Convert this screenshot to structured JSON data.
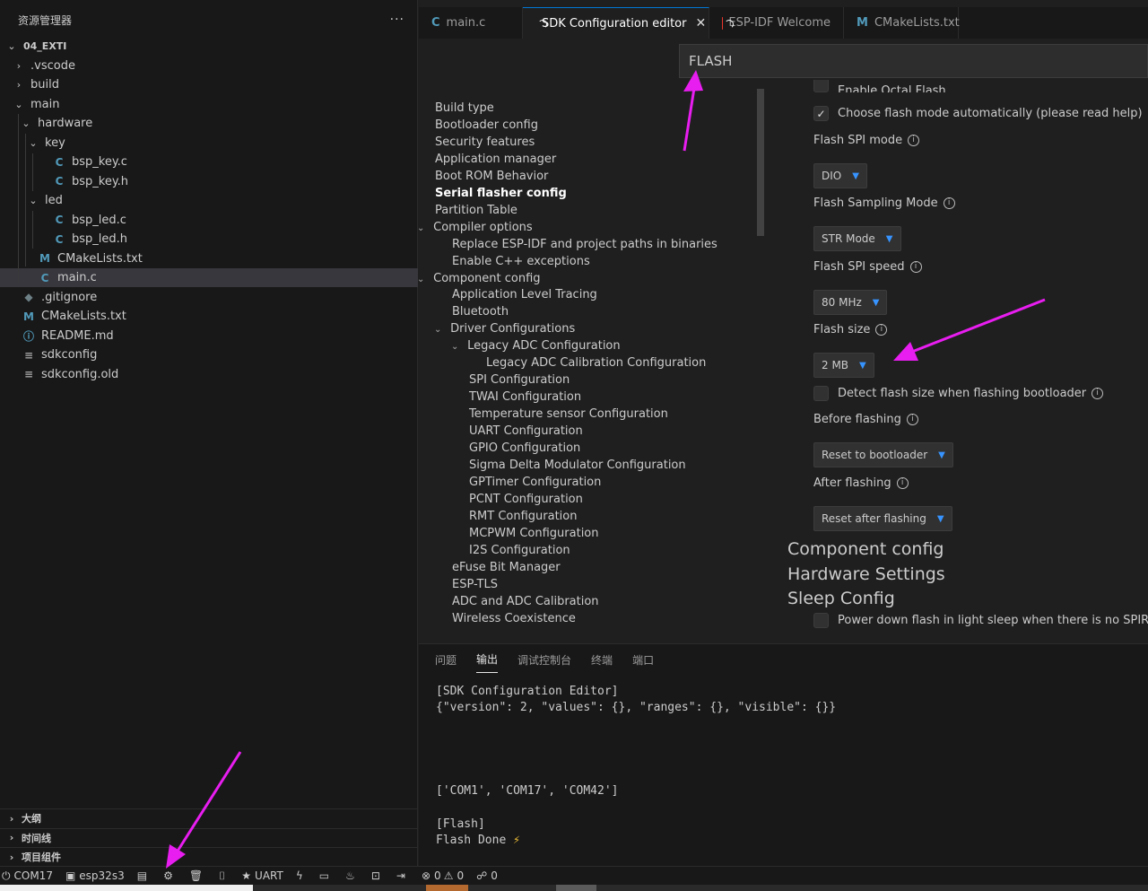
{
  "explorer": {
    "title": "资源管理器",
    "more": "···",
    "tree": [
      {
        "label": "04_EXTI",
        "depth": 0,
        "kind": "folder-open",
        "bold": true
      },
      {
        "label": ".vscode",
        "depth": 1,
        "kind": "folder"
      },
      {
        "label": "build",
        "depth": 1,
        "kind": "folder"
      },
      {
        "label": "main",
        "depth": 1,
        "kind": "folder-open"
      },
      {
        "label": "hardware",
        "depth": 2,
        "kind": "folder-open"
      },
      {
        "label": "key",
        "depth": 3,
        "kind": "folder-open"
      },
      {
        "label": "bsp_key.c",
        "depth": 4,
        "kind": "c"
      },
      {
        "label": "bsp_key.h",
        "depth": 4,
        "kind": "c"
      },
      {
        "label": "led",
        "depth": 3,
        "kind": "folder-open"
      },
      {
        "label": "bsp_led.c",
        "depth": 4,
        "kind": "c"
      },
      {
        "label": "bsp_led.h",
        "depth": 4,
        "kind": "c"
      },
      {
        "label": "CMakeLists.txt",
        "depth": 2,
        "kind": "m"
      },
      {
        "label": "main.c",
        "depth": 2,
        "kind": "c",
        "selected": true
      },
      {
        "label": ".gitignore",
        "depth": 1,
        "kind": "git"
      },
      {
        "label": "CMakeLists.txt",
        "depth": 1,
        "kind": "m"
      },
      {
        "label": "README.md",
        "depth": 1,
        "kind": "info"
      },
      {
        "label": "sdkconfig",
        "depth": 1,
        "kind": "eq"
      },
      {
        "label": "sdkconfig.old",
        "depth": 1,
        "kind": "eq"
      }
    ],
    "sections": [
      "大纲",
      "时间线",
      "项目组件"
    ]
  },
  "tabs": [
    {
      "label": "main.c",
      "icon": "c-file-icon",
      "active": false
    },
    {
      "label": "SDK Configuration editor",
      "icon": "espressif-icon",
      "active": true,
      "close": "✕"
    },
    {
      "label": "ESP-IDF Welcome",
      "icon": "espressif-icon",
      "active": false
    },
    {
      "label": "CMakeLists.txt",
      "icon": "cmake-icon",
      "active": false
    }
  ],
  "sdk_editor": {
    "search_value": "FLASH",
    "menu": [
      {
        "label": "Build type",
        "indent": 0
      },
      {
        "label": "Bootloader config",
        "indent": 0
      },
      {
        "label": "Security features",
        "indent": 0
      },
      {
        "label": "Application manager",
        "indent": 0
      },
      {
        "label": "Boot ROM Behavior",
        "indent": 0
      },
      {
        "label": "Serial flasher config",
        "indent": 0,
        "bold": true
      },
      {
        "label": "Partition Table",
        "indent": 0
      },
      {
        "label": "Compiler options",
        "indent": 0,
        "chevron": true
      },
      {
        "label": "Replace ESP-IDF and project paths in binaries",
        "indent": 1
      },
      {
        "label": "Enable C++ exceptions",
        "indent": 1
      },
      {
        "label": "Component config",
        "indent": 0,
        "chevron": true
      },
      {
        "label": "Application Level Tracing",
        "indent": 1
      },
      {
        "label": "Bluetooth",
        "indent": 1
      },
      {
        "label": "Driver Configurations",
        "indent": 1,
        "chevron": true
      },
      {
        "label": "Legacy ADC Configuration",
        "indent": 2,
        "chevron": true
      },
      {
        "label": "Legacy ADC Calibration Configuration",
        "indent": 3
      },
      {
        "label": "SPI Configuration",
        "indent": 2
      },
      {
        "label": "TWAI Configuration",
        "indent": 2
      },
      {
        "label": "Temperature sensor Configuration",
        "indent": 2
      },
      {
        "label": "UART Configuration",
        "indent": 2
      },
      {
        "label": "GPIO Configuration",
        "indent": 2
      },
      {
        "label": "Sigma Delta Modulator Configuration",
        "indent": 2
      },
      {
        "label": "GPTimer Configuration",
        "indent": 2
      },
      {
        "label": "PCNT Configuration",
        "indent": 2
      },
      {
        "label": "RMT Configuration",
        "indent": 2
      },
      {
        "label": "MCPWM Configuration",
        "indent": 2
      },
      {
        "label": "I2S Configuration",
        "indent": 2
      },
      {
        "label": "eFuse Bit Manager",
        "indent": 1
      },
      {
        "label": "ESP-TLS",
        "indent": 1
      },
      {
        "label": "ADC and ADC Calibration",
        "indent": 1
      },
      {
        "label": "Wireless Coexistence",
        "indent": 1
      }
    ],
    "settings": {
      "octal_flash_label": "Enable Octal Flash",
      "auto_mode_label": "Choose flash mode automatically (please read help)",
      "spi_mode_label": "Flash SPI mode",
      "spi_mode_value": "DIO",
      "sampling_label": "Flash Sampling Mode",
      "sampling_value": "STR Mode",
      "spi_speed_label": "Flash SPI speed",
      "spi_speed_value": "80 MHz",
      "size_label": "Flash size",
      "size_value": "2 MB",
      "detect_label": "Detect flash size when flashing bootloader",
      "before_label": "Before flashing",
      "before_value": "Reset to bootloader",
      "after_label": "After flashing",
      "after_value": "Reset after flashing",
      "groups": [
        "Component config",
        "Hardware Settings",
        "Sleep Config"
      ],
      "power_down_label": "Power down flash in light sleep when there is no SPIRAM"
    }
  },
  "panel": {
    "tabs": [
      "问题",
      "输出",
      "调试控制台",
      "终端",
      "端口"
    ],
    "active_tab": "输出",
    "output": {
      "l1": "[SDK Configuration Editor]",
      "l2": "{\"version\": 2, \"values\": {}, \"ranges\": {}, \"visible\": {}}",
      "l3": "['COM1', 'COM17', 'COM42']",
      "l4": "[Flash]",
      "l5": "Flash Done",
      "bolt": "⚡"
    }
  },
  "statusbar": {
    "port": "COM17",
    "target": "esp32s3",
    "flash_method": "UART",
    "errors": "0",
    "warnings": "0",
    "ports": "0"
  },
  "colors": {
    "accent": "#0078d4",
    "annotation_arrow": "#e81df0",
    "selected_row": "#37373d"
  }
}
